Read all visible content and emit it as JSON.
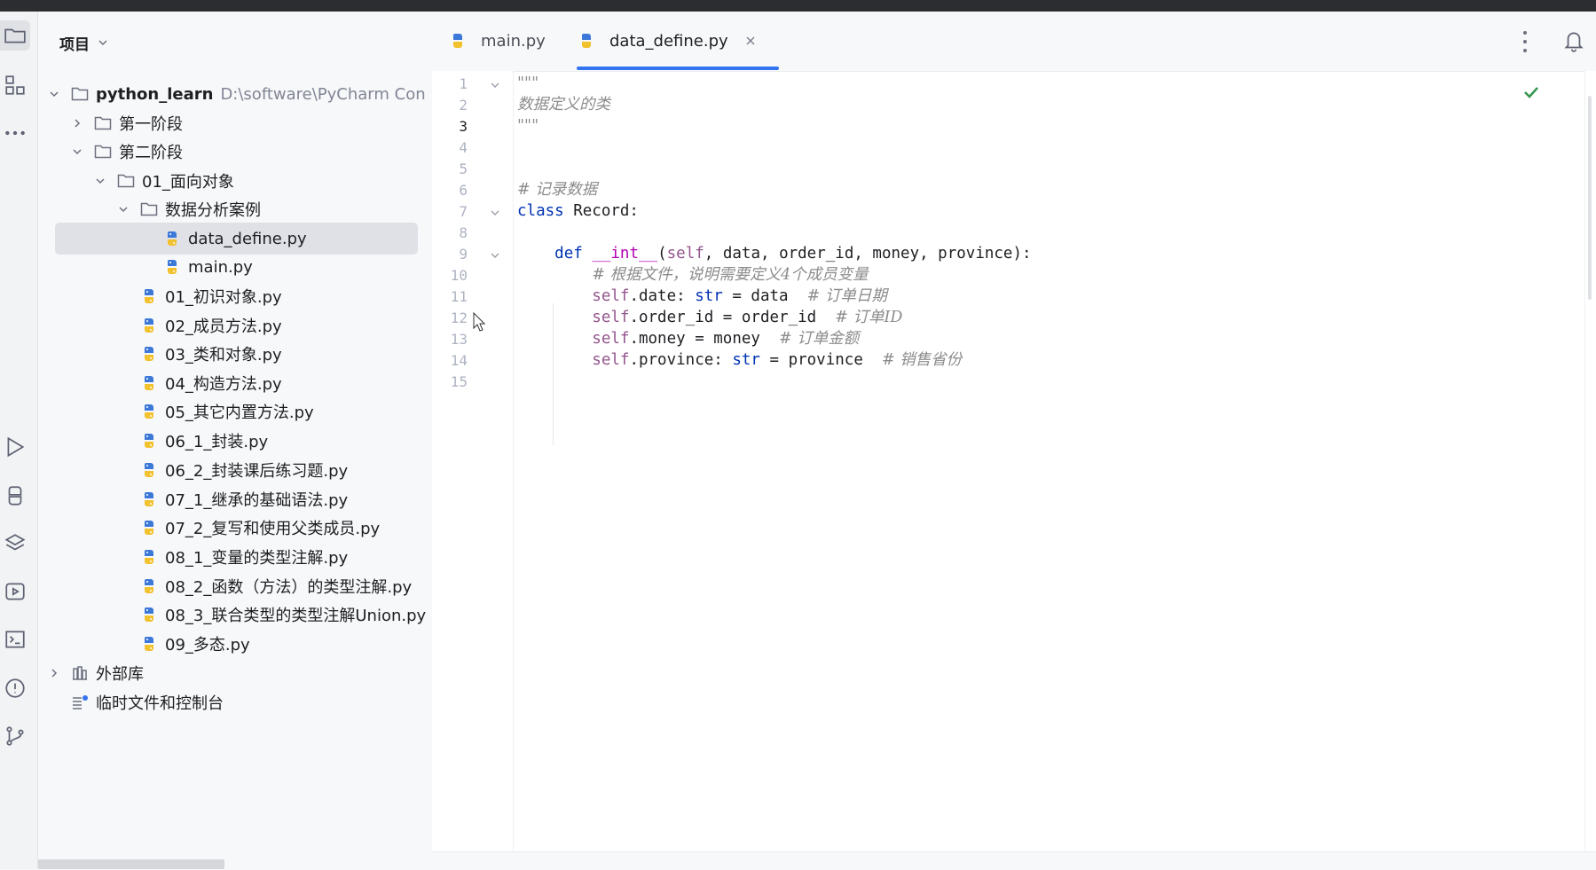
{
  "project_panel": {
    "title": "项目",
    "tree": [
      {
        "label": "python_learn",
        "hint": "D:\\software\\PyCharm Con",
        "type": "folder",
        "level": 0,
        "expanded": true
      },
      {
        "label": "第一阶段",
        "type": "folder",
        "level": 1,
        "expanded": false
      },
      {
        "label": "第二阶段",
        "type": "folder",
        "level": 1,
        "expanded": true
      },
      {
        "label": "01_面向对象",
        "type": "folder",
        "level": 2,
        "expanded": true
      },
      {
        "label": "数据分析案例",
        "type": "folder",
        "level": 3,
        "expanded": true
      },
      {
        "label": "data_define.py",
        "type": "py",
        "level": 4,
        "selected": true
      },
      {
        "label": "main.py",
        "type": "py",
        "level": 4
      },
      {
        "label": "01_初识对象.py",
        "type": "py",
        "level": 3
      },
      {
        "label": "02_成员方法.py",
        "type": "py",
        "level": 3
      },
      {
        "label": "03_类和对象.py",
        "type": "py",
        "level": 3
      },
      {
        "label": "04_构造方法.py",
        "type": "py",
        "level": 3
      },
      {
        "label": "05_其它内置方法.py",
        "type": "py",
        "level": 3
      },
      {
        "label": "06_1_封装.py",
        "type": "py",
        "level": 3
      },
      {
        "label": "06_2_封装课后练习题.py",
        "type": "py",
        "level": 3
      },
      {
        "label": "07_1_继承的基础语法.py",
        "type": "py",
        "level": 3
      },
      {
        "label": "07_2_复写和使用父类成员.py",
        "type": "py",
        "level": 3
      },
      {
        "label": "08_1_变量的类型注解.py",
        "type": "py",
        "level": 3
      },
      {
        "label": "08_2_函数（方法）的类型注解.py",
        "type": "py",
        "level": 3
      },
      {
        "label": "08_3_联合类型的类型注解Union.py",
        "type": "py",
        "level": 3
      },
      {
        "label": "09_多态.py",
        "type": "py",
        "level": 3
      },
      {
        "label": "外部库",
        "type": "lib",
        "level": 0,
        "expanded": false
      },
      {
        "label": "临时文件和控制台",
        "type": "scratch",
        "level": 0
      }
    ]
  },
  "editor": {
    "tabs": [
      {
        "label": "main.py",
        "active": false
      },
      {
        "label": "data_define.py",
        "active": true,
        "closable": true
      }
    ],
    "current_line": 3,
    "lines": [
      [
        {
          "t": "\"\"\"",
          "c": "cm"
        }
      ],
      [
        {
          "t": "数据定义的类",
          "c": "cm"
        }
      ],
      [
        {
          "t": "\"\"\"",
          "c": "cm"
        }
      ],
      [],
      [],
      [
        {
          "t": "# 记录数据",
          "c": "cm"
        }
      ],
      [
        {
          "t": "class ",
          "c": "kw"
        },
        {
          "t": "Record:",
          "c": ""
        }
      ],
      [],
      [
        {
          "t": "    "
        },
        {
          "t": "def ",
          "c": "kw"
        },
        {
          "t": "__int__",
          "c": "fn"
        },
        {
          "t": "("
        },
        {
          "t": "self",
          "c": "slf"
        },
        {
          "t": ", data, order_id, money, province):"
        }
      ],
      [
        {
          "t": "        "
        },
        {
          "t": "# 根据文件，说明需要定义4个成员变量",
          "c": "cm"
        }
      ],
      [
        {
          "t": "        "
        },
        {
          "t": "self",
          "c": "slf"
        },
        {
          "t": ".date: "
        },
        {
          "t": "str",
          "c": "kw"
        },
        {
          "t": " = data  "
        },
        {
          "t": "# 订单日期",
          "c": "cm"
        }
      ],
      [
        {
          "t": "        "
        },
        {
          "t": "self",
          "c": "slf"
        },
        {
          "t": ".order_id = order_id  "
        },
        {
          "t": "# 订单ID",
          "c": "cm"
        }
      ],
      [
        {
          "t": "        "
        },
        {
          "t": "self",
          "c": "slf"
        },
        {
          "t": ".money = money  "
        },
        {
          "t": "# 订单金额",
          "c": "cm"
        }
      ],
      [
        {
          "t": "        "
        },
        {
          "t": "self",
          "c": "slf"
        },
        {
          "t": ".province: "
        },
        {
          "t": "str",
          "c": "kw"
        },
        {
          "t": " = province  "
        },
        {
          "t": "# 销售省份",
          "c": "cm"
        }
      ],
      []
    ]
  },
  "icons": {
    "left_toolbar": [
      "folder-icon",
      "structure-icon",
      "more-icon",
      "run-icon",
      "python-console-icon",
      "layers-icon",
      "services-icon",
      "terminal-icon",
      "problems-icon",
      "git-icon"
    ],
    "check": "check-icon",
    "notifications": "bell-icon"
  },
  "colors": {
    "keyword": "#0033b3",
    "self": "#94558d",
    "dunder": "#b200b2",
    "comment": "#8c8c8c",
    "accent": "#3574f0",
    "check": "#369650"
  }
}
